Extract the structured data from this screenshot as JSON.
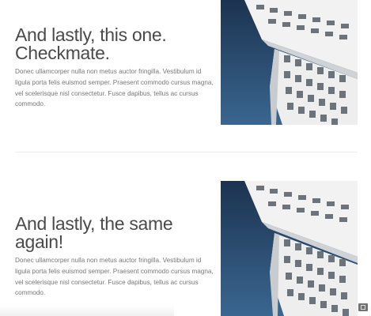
{
  "features": [
    {
      "heading_line1": "And lastly, this one.",
      "heading_line2": "Checkmate.",
      "lead": "Donec ullamcorper nulla non metus auctor fringilla. Vestibulum id ligula porta felis euismod semper. Praesent commodo cursus magna, vel scelerisque nisl consectetur. Fusce dapibus, tellus ac cursus commodo.",
      "image_subject": "building-photo"
    },
    {
      "heading_line1": "And lastly, the same",
      "heading_line2": "again!",
      "lead": "Donec ullamcorper nulla non metus auctor fringilla. Vestibulum id ligula porta felis euismod semper. Praesent commodo cursus magna, vel scelerisque nisl consectetur. Fusce dapibus, tellus ac cursus commodo.",
      "image_subject": "building-photo"
    }
  ],
  "colors": {
    "sky_top": "#1c3350",
    "sky_bottom": "#3a6690",
    "building": "#f2f2f2",
    "window": "#6d737a"
  },
  "icons": {
    "fullscreen": "fullscreen-icon"
  }
}
